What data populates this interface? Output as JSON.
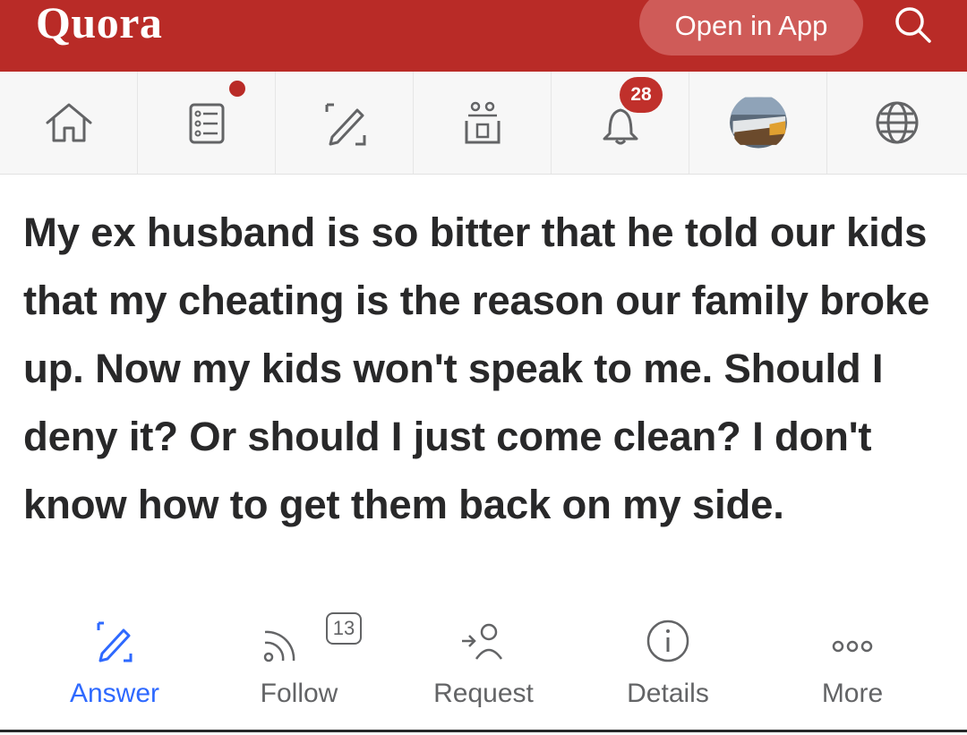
{
  "header": {
    "logo": "Quora",
    "open_app_label": "Open in App",
    "search_icon": "search-icon"
  },
  "colors": {
    "brand_red": "#b92b27",
    "answer_blue": "#2e69ff",
    "text_dark": "#282829",
    "text_gray": "#636466"
  },
  "nav": {
    "items": [
      {
        "icon": "home-icon"
      },
      {
        "icon": "following-feed-icon"
      },
      {
        "icon": "write-icon"
      },
      {
        "icon": "spaces-icon"
      },
      {
        "icon": "bell-icon",
        "badge": "28"
      },
      {
        "icon": "avatar"
      },
      {
        "icon": "globe-icon"
      }
    ]
  },
  "question": {
    "text": "My ex husband is so bitter that he told our kids that my cheating is the reason our family broke up. Now my kids won't speak to me. Should I deny it? Or should I just come clean? I don't know how to get them back on my side."
  },
  "actions": {
    "answer": "Answer",
    "follow": "Follow",
    "follow_count": "13",
    "request": "Request",
    "details": "Details",
    "more": "More"
  }
}
